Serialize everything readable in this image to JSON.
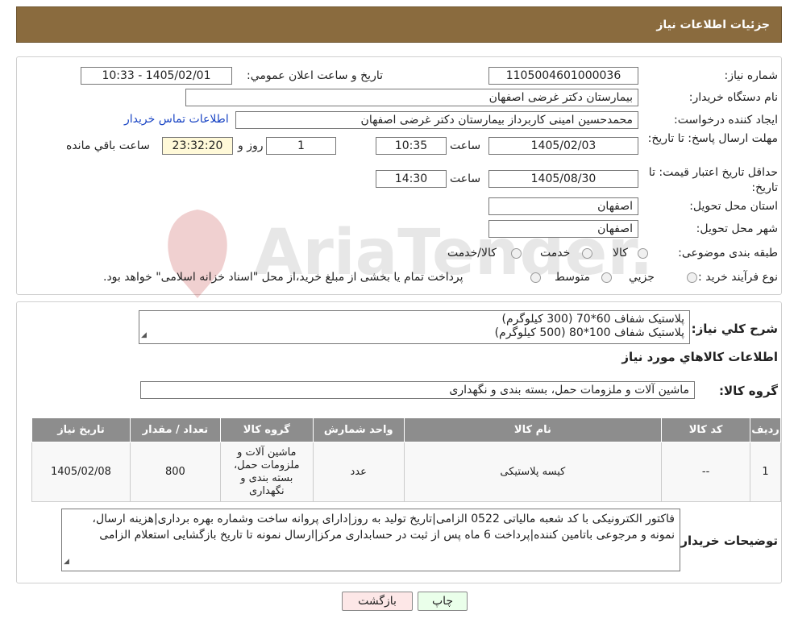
{
  "page": {
    "title": "جزئیات اطلاعات نیاز"
  },
  "fields": {
    "need_number_label": "شماره نیاز:",
    "need_number": "1105004601000036",
    "announce_label": "تاریخ و ساعت اعلان عمومي:",
    "announce_value": "1405/02/01 - 10:33",
    "buyer_org_label": "نام دستگاه خریدار:",
    "buyer_org": "بیمارستان دکتر غرضی اصفهان",
    "requester_label": "ایجاد کننده درخواست:",
    "requester": "محمدحسین امینی کاربرداز بیمارستان دکتر غرضی اصفهان",
    "contact_link": "اطلاعات تماس خریدار",
    "deadline_label": "مهلت ارسال پاسخ: تا تاریخ:",
    "deadline_date": "1405/02/03",
    "time_label": "ساعت",
    "deadline_time": "10:35",
    "deadline_days": "1",
    "days_label": "روز و",
    "remaining_time": "23:32:20",
    "remaining_label": "ساعت باقي مانده",
    "validity_label": "حداقل تاريخ اعتبار قيمت: تا تاريخ:",
    "validity_date": "1405/08/30",
    "validity_time": "14:30",
    "province_label": "استان محل تحویل:",
    "province": "اصفهان",
    "city_label": "شهر محل تحویل:",
    "city": "اصفهان",
    "category_label": "طبقه بندی موضوعی:",
    "category_options": [
      "کالا",
      "خدمت",
      "کالا/خدمت"
    ],
    "process_label": "نوع فرآیند خرید :",
    "process_options": [
      "جزیي",
      "متوسط"
    ],
    "process_note": "پرداخت تمام یا بخشی از مبلغ خرید،از محل \"اسناد خزانه اسلامی\" خواهد بود."
  },
  "summary": {
    "label": "شرح کلي نياز:",
    "line1": "پلاستیک شفاف 60*70 (300 کیلوگرم)",
    "line2": "پلاستیک شفاف 100*80 (500 کیلوگرم)"
  },
  "goods": {
    "section_title": "اطلاعات کالاهاي مورد نياز",
    "group_label": "گروه کالا:",
    "group_value": "ماشین آلات و ملزومات حمل، بسته بندی و نگهداری"
  },
  "table": {
    "headers": [
      "رديف",
      "کد کالا",
      "نام کالا",
      "واحد شمارش",
      "گروه کالا",
      "تعداد / مقدار",
      "تاریخ نیاز"
    ],
    "rows": [
      [
        "1",
        "--",
        "کیسه پلاستیکی",
        "عدد",
        "ماشین آلات و ملزومات حمل، بسته بندی و نگهداری",
        "800",
        "1405/02/08"
      ]
    ]
  },
  "buyer_notes": {
    "label": "توضیحات خریدار:",
    "text": "فاکتور الکترونیکی با کد شعبه مالیاتی 0522 الزامی|تاریخ تولید به روز|دارای پروانه ساخت وشماره بهره برداری|هزینه ارسال، نمونه و مرجوعی باتامین کننده|پرداخت 6 ماه پس از ثبت در حسابداری مرکز|ارسال نمونه تا تاریخ بازگشایی استعلام الزامی"
  },
  "buttons": {
    "print": "چاپ",
    "back": "بازگشت"
  },
  "watermark": {
    "text": "AriaTender.neT"
  },
  "colors": {
    "header_bg": "#8a6b3e",
    "table_header_bg": "#8d8d8d",
    "link": "#1a45c4",
    "back_button_bg": "#fde7e7",
    "print_button_bg": "#eaffea"
  }
}
